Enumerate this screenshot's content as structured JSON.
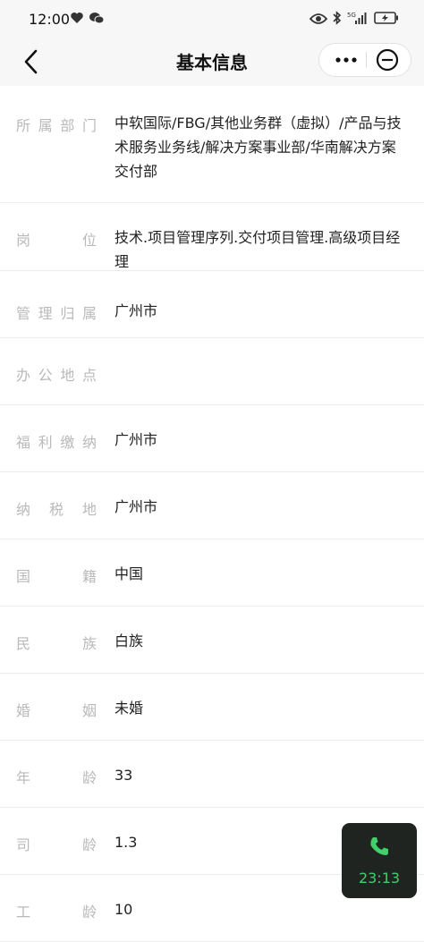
{
  "status_bar": {
    "time": "12:00",
    "network": "5G",
    "left_icons": [
      "heart-icon",
      "wechat-icon"
    ],
    "right_icons": [
      "eye-icon",
      "bluetooth-icon",
      "signal-icon",
      "battery-charging-icon"
    ]
  },
  "nav": {
    "title": "基本信息"
  },
  "rows": [
    {
      "label": "所属部门",
      "value": "中软国际/FBG/其他业务群（虚拟）/产品与技术服务业务线/解决方案事业部/华南解决方案交付部"
    },
    {
      "label": "岗位",
      "value": "技术.项目管理序列.交付项目管理.高级项目经理"
    },
    {
      "label": "管理归属",
      "value": "广州市"
    },
    {
      "label": "办公地点",
      "value": ""
    },
    {
      "label": "福利缴纳",
      "value": "广州市"
    },
    {
      "label": "纳税地",
      "value": "广州市"
    },
    {
      "label": "国籍",
      "value": "中国"
    },
    {
      "label": "民族",
      "value": "白族"
    },
    {
      "label": "婚姻",
      "value": "未婚"
    },
    {
      "label": "年龄",
      "value": "33"
    },
    {
      "label": "司龄",
      "value": "1.3"
    },
    {
      "label": "工龄",
      "value": "10"
    }
  ],
  "call": {
    "duration": "23:13",
    "color": "#3fd06a"
  }
}
